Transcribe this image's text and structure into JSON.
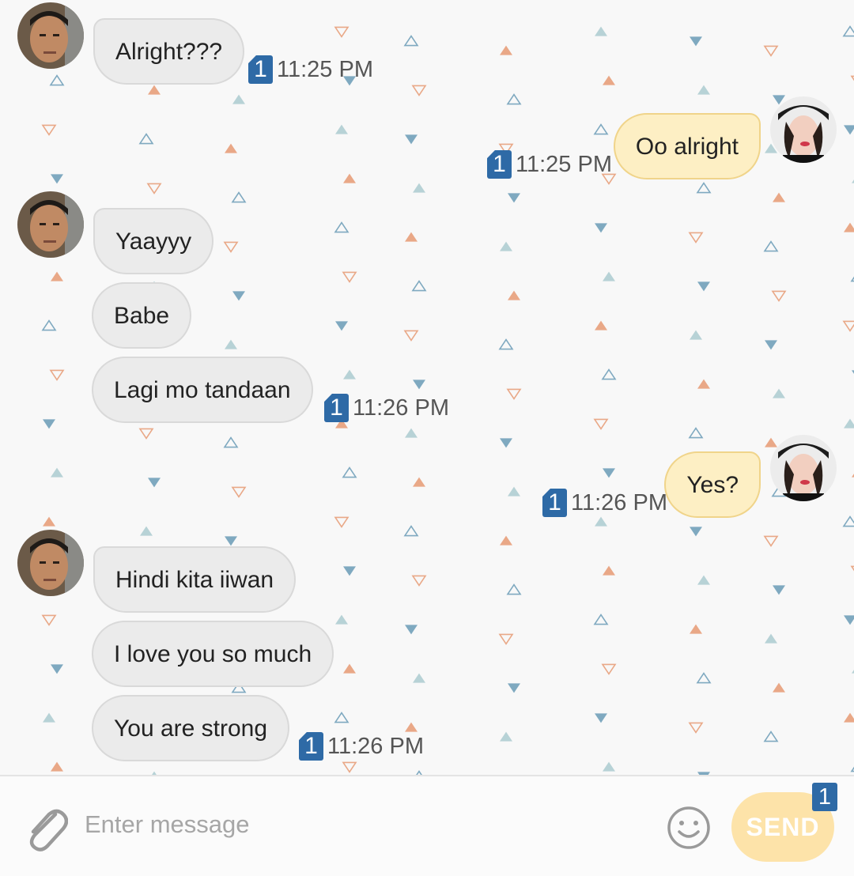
{
  "conversation": {
    "messages": [
      {
        "from": "other",
        "text": "Alright???"
      },
      {
        "from": "me",
        "text": "Oo alright"
      },
      {
        "from": "other",
        "text": "Yaayyy"
      },
      {
        "from": "other",
        "text": "Babe"
      },
      {
        "from": "other",
        "text": "Lagi mo tandaan"
      },
      {
        "from": "me",
        "text": "Yes?"
      },
      {
        "from": "other",
        "text": "Hindi kita iiwan"
      },
      {
        "from": "other",
        "text": "I love you so much"
      },
      {
        "from": "other",
        "text": "You are strong"
      }
    ],
    "receipts": [
      {
        "unread": "1",
        "time": "11:25 PM"
      },
      {
        "unread": "1",
        "time": "11:25 PM"
      },
      {
        "unread": "1",
        "time": "11:26 PM"
      },
      {
        "unread": "1",
        "time": "11:26 PM"
      },
      {
        "unread": "1",
        "time": "11:26 PM"
      }
    ]
  },
  "composer": {
    "placeholder": "Enter message",
    "send_label": "SEND",
    "send_badge": "1",
    "attach_icon": "paperclip-icon",
    "emoji_icon": "smiley-icon"
  },
  "colors": {
    "incoming_bubble": "#ebebeb",
    "outgoing_bubble": "#fdefc4",
    "unread_badge": "#2e6aa6",
    "send_button": "#fde3a9"
  }
}
